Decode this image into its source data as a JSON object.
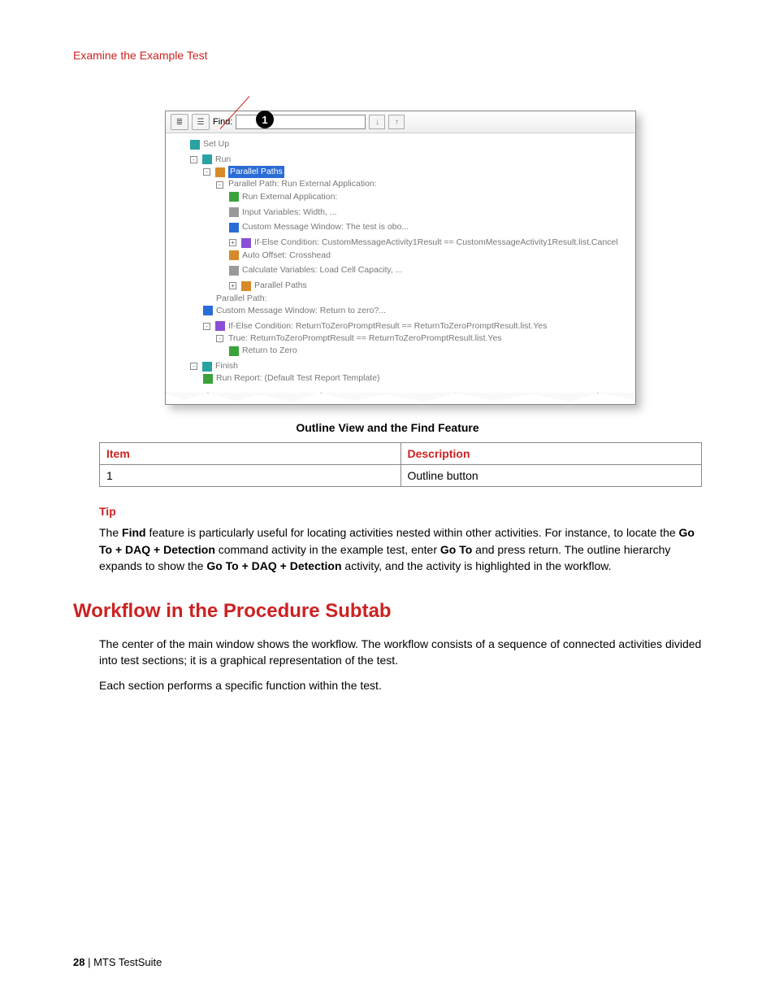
{
  "breadcrumb": "Examine the Example Test",
  "callout_number": "1",
  "toolbar": {
    "find_label": "Find:",
    "find_value": "",
    "down_glyph": "↓",
    "up_glyph": "↑"
  },
  "tree": {
    "setup": "Set Up",
    "run": "Run",
    "parallel_paths_sel": "Parallel Paths",
    "pp_run_ext": "Parallel Path: Run External Application:",
    "run_ext_app": "Run External Application:",
    "input_vars": "Input Variables: Width, ...",
    "custom_msg_obo": "Custom Message Window: The test is obo...",
    "ifelse_cancel": "If-Else Condition: CustomMessageActivity1Result == CustomMessageActivity1Result.list.Cancel",
    "auto_offset": "Auto Offset: Crosshead",
    "calc_vars": "Calculate Variables: Load Cell Capacity, ...",
    "parallel_paths_inner": "Parallel Paths",
    "parallel_path_empty": "Parallel Path:",
    "custom_msg_zero": "Custom Message Window: Return to zero?...",
    "ifelse_yes": "If-Else Condition: ReturnToZeroPromptResult == ReturnToZeroPromptResult.list.Yes",
    "true_branch": "True: ReturnToZeroPromptResult == ReturnToZeroPromptResult.list.Yes",
    "return_to_zero": "Return to Zero",
    "finish": "Finish",
    "run_report": "Run Report: (Default Test Report Template)"
  },
  "caption": "Outline View and the Find Feature",
  "table": {
    "h_item": "Item",
    "h_desc": "Description",
    "r1_item": "1",
    "r1_desc": "Outline button"
  },
  "tip": {
    "heading": "Tip",
    "p1a": "The ",
    "p1b": "Find",
    "p1c": " feature is particularly useful for locating activities nested within other activities. For instance, to locate the ",
    "p1d": "Go To + DAQ + Detection",
    "p1e": " command activity in the example test, enter ",
    "p1f": "Go To",
    "p1g": " and press return. The outline hierarchy expands to show the ",
    "p1h": "Go To + DAQ + Detection",
    "p1i": " activity, and the activity is highlighted in the workflow."
  },
  "section": {
    "heading": "Workflow in the Procedure Subtab",
    "p1": "The center of the main window shows the workflow. The workflow consists of a sequence of connected activities divided into test sections; it is a graphical representation of the test.",
    "p2": "Each section performs a specific function within the test."
  },
  "footer": {
    "page": "28",
    "sep": " | ",
    "product": "MTS TestSuite"
  }
}
